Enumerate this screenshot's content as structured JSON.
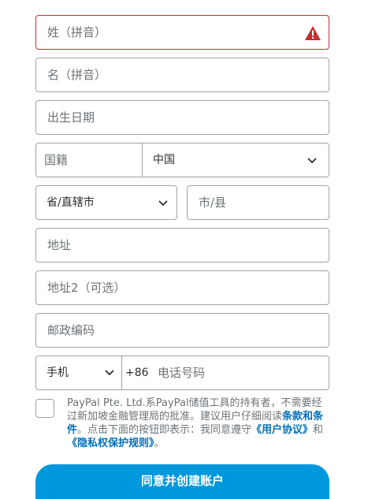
{
  "form": {
    "last_name": {
      "placeholder": "姓（拼音）",
      "status": "error"
    },
    "first_name": {
      "placeholder": "名（拼音）"
    },
    "birth_date": {
      "placeholder": "出生日期"
    },
    "nationality": {
      "label": "国籍",
      "value": "中国"
    },
    "province": {
      "value": "省/直辖市"
    },
    "city": {
      "placeholder": "市/县"
    },
    "address1": {
      "placeholder": "地址"
    },
    "address2": {
      "placeholder": "地址2（可选）"
    },
    "postal_code": {
      "placeholder": "邮政编码"
    },
    "phone": {
      "type": "手机",
      "country_code": "+86",
      "placeholder": "电话号码"
    }
  },
  "legal": {
    "text1": "PayPal Pte. Ltd.系PayPal储值工具的持有者，不需要经过新加坡金融管理局的批准。建议用户仔细阅读",
    "link_terms": "条款和条件",
    "text2": "。点击下面的按钮即表示：我同意遵守",
    "link_agreement": "《用户协议》",
    "text3": "和",
    "link_privacy": "《隐私权保护规则》",
    "text4": "。"
  },
  "submit_label": "同意并创建账户",
  "colors": {
    "error": "#c72e2e",
    "link": "#0070ba",
    "button": "#0098dc"
  },
  "icons": {
    "error": "warning-triangle-icon",
    "dropdown": "chevron-down-icon"
  }
}
